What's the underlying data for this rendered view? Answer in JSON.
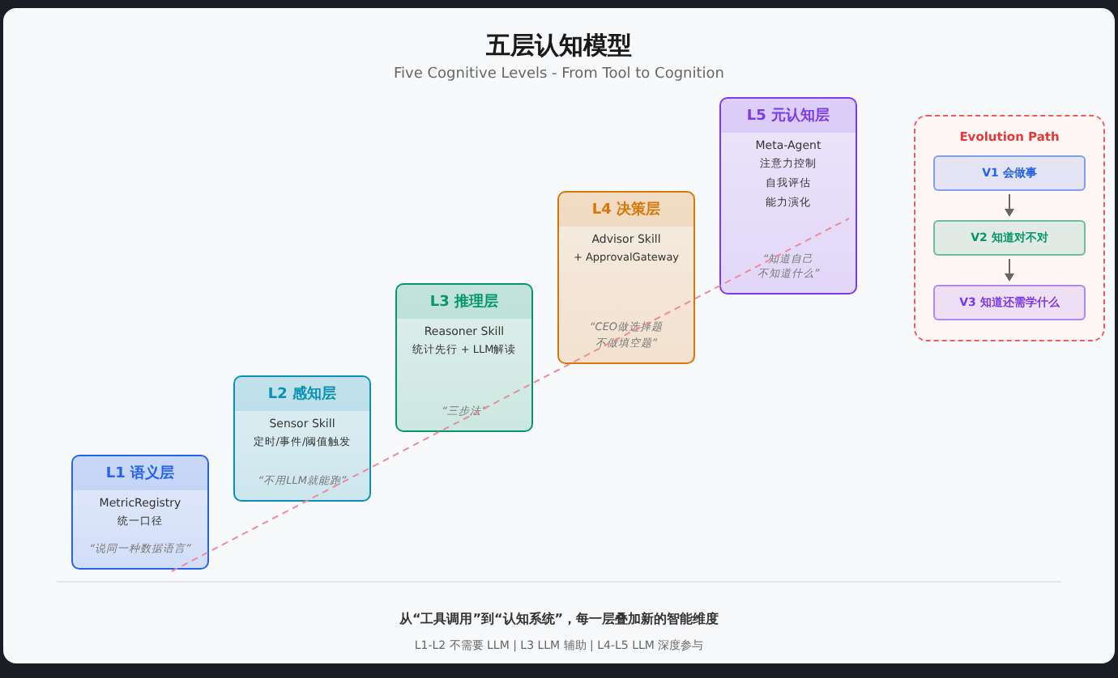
{
  "title": "五层认知模型",
  "subtitle": "Five Cognitive Levels - From Tool to Cognition",
  "levels": [
    {
      "title": "L1 语义层",
      "color": "#2563eb",
      "skill": "MetricRegistry",
      "lines": [
        "统一口径"
      ],
      "quote": [
        "“说同一种数据语言”"
      ]
    },
    {
      "title": "L2 感知层",
      "color": "#0891b2",
      "skill": "Sensor Skill",
      "lines": [
        "定时/事件/阈值触发"
      ],
      "quote": [
        "“不用LLM就能跑”"
      ]
    },
    {
      "title": "L3 推理层",
      "color": "#059669",
      "skill": "Reasoner Skill",
      "lines": [
        "统计先行 + LLM解读"
      ],
      "quote": [
        "“三步法”"
      ]
    },
    {
      "title": "L4 决策层",
      "color": "#d97706",
      "skill": "Advisor Skill",
      "lines": [
        "+ ApprovalGateway"
      ],
      "quote": [
        "“CEO做选择题",
        "不做填空题”"
      ]
    },
    {
      "title": "L5 元认知层",
      "color": "#7c3aed",
      "skill": "Meta-Agent",
      "lines": [
        "注意力控制",
        "自我评估",
        "能力演化"
      ],
      "quote": [
        "“知道自己",
        "不知道什么”"
      ]
    }
  ],
  "evolution": {
    "title": "Evolution Path",
    "steps": [
      {
        "label": "V1 会做事",
        "color": "#2563eb"
      },
      {
        "label": "V2 知道对不对",
        "color": "#059669"
      },
      {
        "label": "V3 知道还需学什么",
        "color": "#7c3aed"
      }
    ]
  },
  "footer": {
    "headline": "从“工具调用”到“认知系统”，每一层叠加新的智能维度",
    "note": "L1-L2 不需要 LLM | L3 LLM 辅助 | L4-L5 LLM 深度参与"
  }
}
